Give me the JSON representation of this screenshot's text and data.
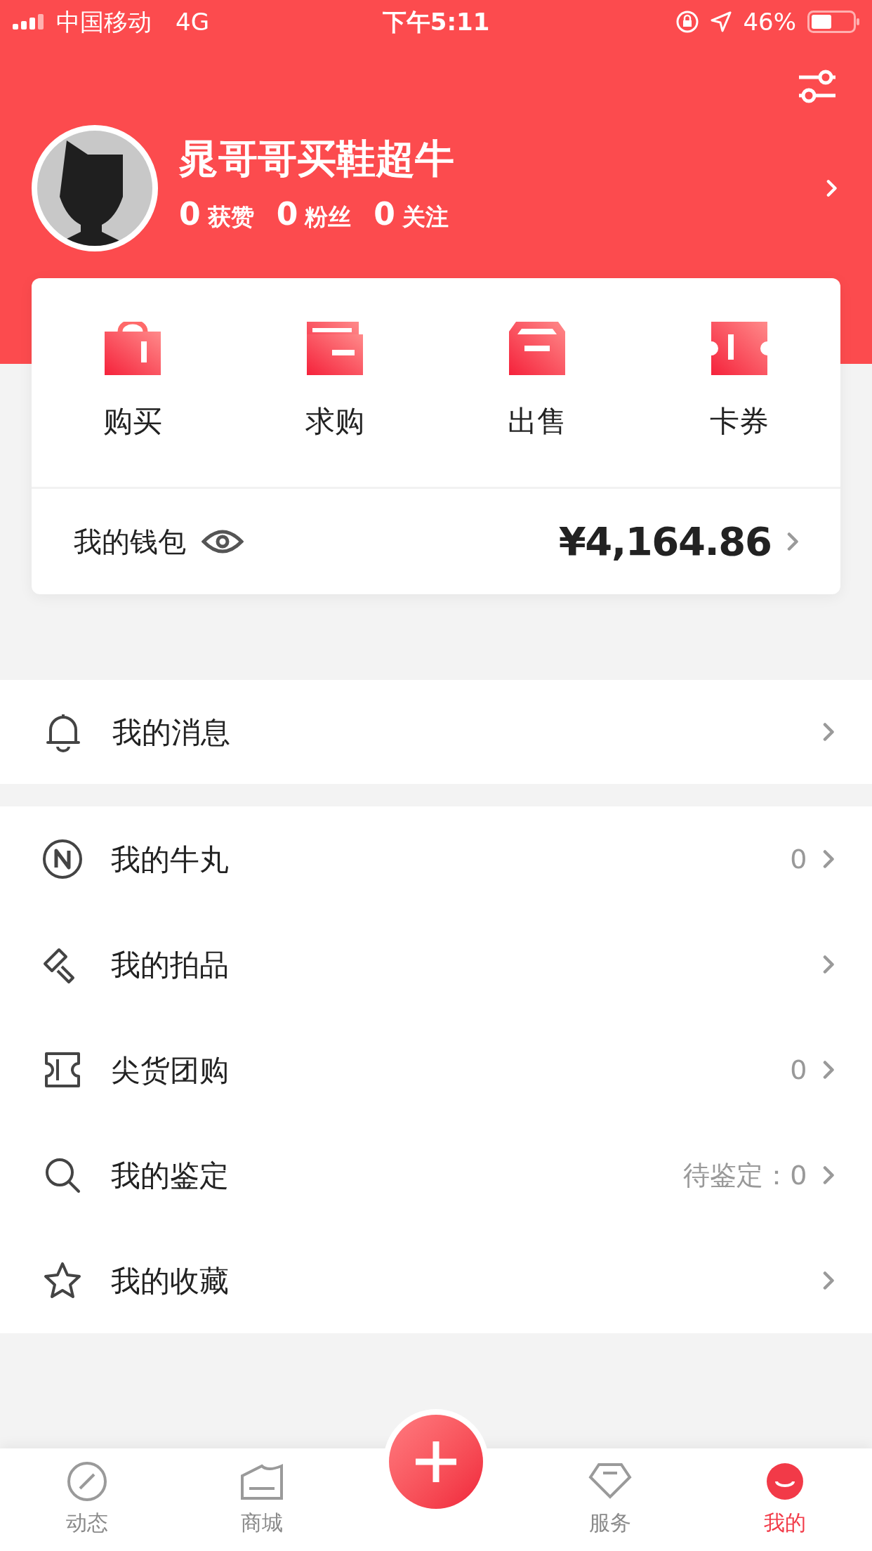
{
  "status_bar": {
    "carrier": "中国移动",
    "network": "4G",
    "time": "下午5:11",
    "battery": "46%"
  },
  "profile": {
    "name": "晁哥哥买鞋超牛",
    "stats": [
      {
        "count": "0",
        "label": "获赞"
      },
      {
        "count": "0",
        "label": "粉丝"
      },
      {
        "count": "0",
        "label": "关注"
      }
    ]
  },
  "actions": [
    {
      "label": "购买"
    },
    {
      "label": "求购"
    },
    {
      "label": "出售"
    },
    {
      "label": "卡券"
    }
  ],
  "wallet": {
    "label": "我的钱包",
    "amount": "¥4,164.86"
  },
  "message_row": {
    "label": "我的消息"
  },
  "menu": [
    {
      "label": "我的牛丸",
      "value": "0"
    },
    {
      "label": "我的拍品"
    },
    {
      "label": "尖货团购",
      "value": "0"
    },
    {
      "label": "我的鉴定",
      "value": "待鉴定：0"
    },
    {
      "label": "我的收藏"
    }
  ],
  "tab_bar": [
    {
      "label": "动态",
      "selected": false
    },
    {
      "label": "商城",
      "selected": false
    },
    {
      "kind": "plus"
    },
    {
      "label": "服务",
      "selected": false
    },
    {
      "label": "我的",
      "selected": true
    }
  ]
}
